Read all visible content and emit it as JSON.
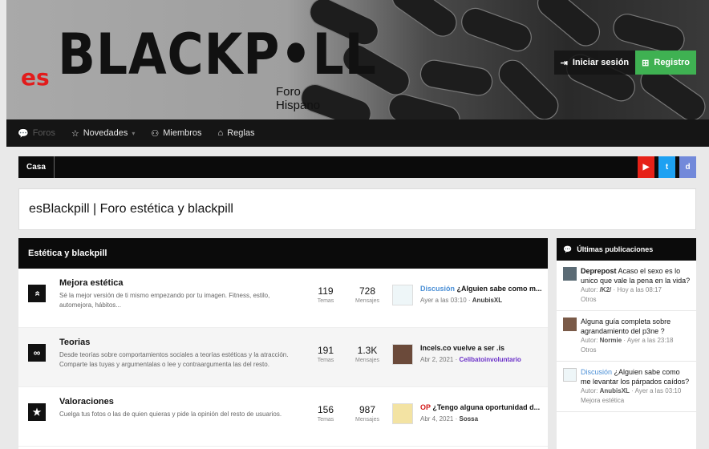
{
  "header": {
    "logo_prefix": "es",
    "logo_main": "BLACKP•LL",
    "logo_sub": "Foro Hispano",
    "login_label": "Iniciar sesión",
    "register_label": "Registro"
  },
  "nav": {
    "items": [
      {
        "label": "Foros",
        "icon": "chat-bubbles-icon"
      },
      {
        "label": "Novedades",
        "icon": "star-icon"
      },
      {
        "label": "Miembros",
        "icon": "person-icon"
      },
      {
        "label": "Reglas",
        "icon": "tag-icon"
      }
    ]
  },
  "breadcrumb": {
    "label": "Casa"
  },
  "social": {
    "youtube": "▶",
    "twitter": "t",
    "discord": "d",
    "colors": {
      "youtube": "#e62117",
      "twitter": "#1da1f2",
      "discord": "#7289da"
    }
  },
  "page": {
    "title": "esBlackpill | Foro estética y blackpill"
  },
  "category": {
    "title": "Estética y blackpill"
  },
  "nodes": [
    {
      "icon": "double-chevron-up-icon",
      "icon_glyph": "»",
      "title": "Mejora estética",
      "description": "Sé la mejor versión de ti mismo empezando por tu imagen. Fitness, estilo, automejora, hábitos...",
      "threads": "119",
      "threads_label": "Temas",
      "messages": "728",
      "messages_label": "Mensajes",
      "last_prefix": "Discusión",
      "last_title": "¿Alguien sabe como m...",
      "last_time": "Ayer a las 03:10",
      "last_user": "AnubisXL"
    },
    {
      "icon": "glasses-icon",
      "icon_glyph": "∞",
      "title": "Teorias",
      "description": "Desde teorías sobre comportamientos sociales a teorías estéticas y la atracción. Comparte las tuyas y argumentalas o lee y contraargumenta las del resto.",
      "threads": "191",
      "threads_label": "Temas",
      "messages": "1.3K",
      "messages_label": "Mensajes",
      "last_prefix": "",
      "last_title": "Incels.co vuelve a ser .is",
      "last_time": "Abr 2, 2021",
      "last_user": "Celibatoinvoluntario"
    },
    {
      "icon": "star-icon",
      "icon_glyph": "★",
      "title": "Valoraciones",
      "description": "Cuelga tus fotos o las de quien quieras y pide la opinión del resto de usuarios.",
      "threads": "156",
      "threads_label": "Temas",
      "messages": "987",
      "messages_label": "Mensajes",
      "last_prefix": "OP",
      "last_title": "¿Tengo alguna oportunidad d...",
      "last_time": "Abr 4, 2021",
      "last_user": "Sossa"
    }
  ],
  "sidebar": {
    "title": "Últimas publicaciones",
    "posts": [
      {
        "prefix": "",
        "title": "Deprepost",
        "text": "Acaso el sexo es lo unico que vale la pena en la vida?",
        "author_label": "Autor:",
        "author": "/K2/",
        "time": "Hoy a las 08:17",
        "forum": "Otros"
      },
      {
        "prefix": "",
        "title": "",
        "text": "Alguna guía completa sobre agrandamiento del p3ne ?",
        "author_label": "Autor:",
        "author": "Normie",
        "time": "Ayer a las 23:18",
        "forum": "Otros"
      },
      {
        "prefix": "Discusión",
        "title": "",
        "text": "¿Alguien sabe como me levantar los párpados caídos?",
        "author_label": "Autor:",
        "author": "AnubisXL",
        "time": "Ayer a las 03:10",
        "forum": "Mejora estética"
      }
    ]
  }
}
